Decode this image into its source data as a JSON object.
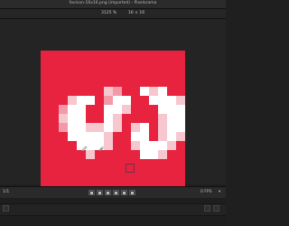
{
  "window": {
    "title": "favicon-16x16.png (imported) - Pixelorama"
  },
  "options_bar": {
    "zoom": "3125 %",
    "canvas_size": "16 × 16"
  },
  "canvas": {
    "background_color": "#E8233F",
    "rows": [
      "................",
      "................",
      "................",
      "................",
      ".......LD..WLW..",
      "...LWW.DWW..WWWL",
      "..DWW..WWL...WWW",
      "..LWW..WL....LWW",
      "..DWWLLWL.LW.LWW",
      "...WWWWL..WW.LWL",
      "....WWWL..LWWWL.",
      ".....L.....WWL..",
      "................",
      "................",
      "................",
      "................"
    ],
    "palette": {
      "W": "#FFFFFF",
      "L": "#F7C7D0",
      "D": "#F39AA9",
      ".": "#E8233F"
    }
  },
  "tools": [
    {
      "name": "pencil-tool-icon"
    },
    {
      "name": "color-picker-icon"
    }
  ],
  "animation": {
    "frame_label": "1/1",
    "controls": [
      "first-frame",
      "previous-frame",
      "play-backward",
      "play-forward",
      "next-frame",
      "last-frame"
    ],
    "fps": "0 FPS"
  }
}
